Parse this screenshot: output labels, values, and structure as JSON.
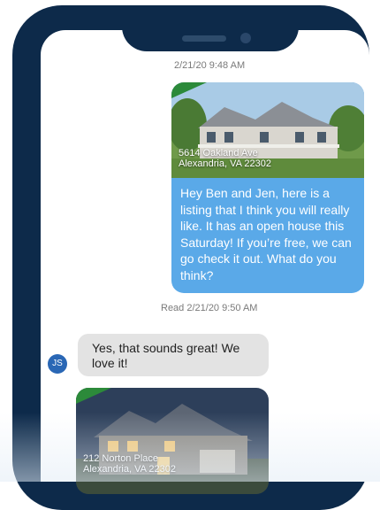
{
  "messages": {
    "timestamp_top": "2/21/20 9:48 AM",
    "outgoing": {
      "address_line1": "5614 Oakland Ave",
      "address_line2": "Alexandria, VA 22302",
      "text": "Hey Ben and Jen, here is a listing that I think you will really like. It has an open house this Saturday! If you’re free, we can go check it out. What do you think?"
    },
    "read_receipt": "Read 2/21/20 9:50 AM",
    "incoming": {
      "avatar_initials": "JS",
      "text": "Yes, that sounds great! We love it!"
    },
    "listing2": {
      "address_line1": "212 Norton Place",
      "address_line2": "Alexandria, VA 22302"
    }
  },
  "colors": {
    "frame": "#0d2a4a",
    "outgoing_bubble": "#5aa9e8",
    "incoming_bubble": "#e3e3e3",
    "avatar": "#2a67b5",
    "ribbon": "#2c8a3a"
  }
}
